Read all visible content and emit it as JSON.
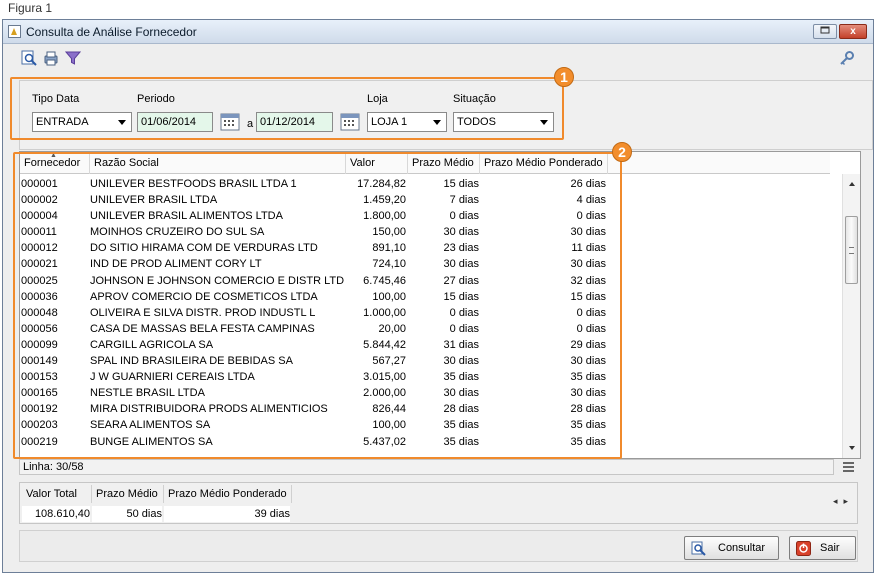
{
  "figure_label": "Figura 1",
  "window": {
    "title": "Consulta de Análise Fornecedor",
    "close_glyph": "x"
  },
  "filters": {
    "tipo_data_label": "Tipo Data",
    "tipo_data_value": "ENTRADA",
    "periodo_label": "Periodo",
    "date_start": "01/06/2014",
    "date_separator": "a",
    "date_end": "01/12/2014",
    "loja_label": "Loja",
    "loja_value": "LOJA 1",
    "situacao_label": "Situação",
    "situacao_value": "TODOS"
  },
  "badges": {
    "filters": "1",
    "grid": "2"
  },
  "grid": {
    "columns": [
      "Fornecedor",
      "Razão Social",
      "Valor",
      "Prazo Médio",
      "Prazo Médio Ponderado"
    ],
    "rows": [
      {
        "code": "000001",
        "name": "UNILEVER BESTFOODS BRASIL LTDA 1",
        "valor": "17.284,82",
        "prazo": "15 dias",
        "ponderado": "26 dias"
      },
      {
        "code": "000002",
        "name": "UNILEVER BRASIL LTDA",
        "valor": "1.459,20",
        "prazo": "7 dias",
        "ponderado": "4 dias"
      },
      {
        "code": "000004",
        "name": "UNILEVER BRASIL ALIMENTOS LTDA",
        "valor": "1.800,00",
        "prazo": "0 dias",
        "ponderado": "0 dias"
      },
      {
        "code": "000011",
        "name": "MOINHOS CRUZEIRO DO SUL SA",
        "valor": "150,00",
        "prazo": "30 dias",
        "ponderado": "30 dias"
      },
      {
        "code": "000012",
        "name": "DO SITIO HIRAMA COM DE VERDURAS LTD",
        "valor": "891,10",
        "prazo": "23 dias",
        "ponderado": "11 dias"
      },
      {
        "code": "000021",
        "name": "IND DE PROD ALIMENT CORY LT",
        "valor": "724,10",
        "prazo": "30 dias",
        "ponderado": "30 dias"
      },
      {
        "code": "000025",
        "name": "JOHNSON E JOHNSON COMERCIO E DISTR LTD",
        "valor": "6.745,46",
        "prazo": "27 dias",
        "ponderado": "32 dias"
      },
      {
        "code": "000036",
        "name": "APROV COMERCIO DE COSMETICOS LTDA",
        "valor": "100,00",
        "prazo": "15 dias",
        "ponderado": "15 dias"
      },
      {
        "code": "000048",
        "name": "OLIVEIRA E SILVA DISTR. PROD INDUSTL L",
        "valor": "1.000,00",
        "prazo": "0 dias",
        "ponderado": "0 dias"
      },
      {
        "code": "000056",
        "name": "CASA DE MASSAS BELA FESTA CAMPINAS",
        "valor": "20,00",
        "prazo": "0 dias",
        "ponderado": "0 dias"
      },
      {
        "code": "000099",
        "name": "CARGILL AGRICOLA SA",
        "valor": "5.844,42",
        "prazo": "31 dias",
        "ponderado": "29 dias"
      },
      {
        "code": "000149",
        "name": "SPAL IND BRASILEIRA DE BEBIDAS SA",
        "valor": "567,27",
        "prazo": "30 dias",
        "ponderado": "30 dias"
      },
      {
        "code": "000153",
        "name": "J W GUARNIERI CEREAIS LTDA",
        "valor": "3.015,00",
        "prazo": "35 dias",
        "ponderado": "35 dias"
      },
      {
        "code": "000165",
        "name": "NESTLE BRASIL LTDA",
        "valor": "2.000,00",
        "prazo": "30 dias",
        "ponderado": "30 dias"
      },
      {
        "code": "000192",
        "name": "MIRA DISTRIBUIDORA PRODS ALIMENTICIOS",
        "valor": "826,44",
        "prazo": "28 dias",
        "ponderado": "28 dias"
      },
      {
        "code": "000203",
        "name": "SEARA ALIMENTOS SA",
        "valor": "100,00",
        "prazo": "35 dias",
        "ponderado": "35 dias"
      },
      {
        "code": "000219",
        "name": "BUNGE ALIMENTOS SA",
        "valor": "5.437,02",
        "prazo": "35 dias",
        "ponderado": "35 dias"
      }
    ]
  },
  "status": {
    "linha": "Linha: 30/58"
  },
  "summary": {
    "valor_total_label": "Valor Total",
    "prazo_medio_label": "Prazo Médio",
    "prazo_ponderado_label": "Prazo Médio Ponderado",
    "valor_total": "108.610,40",
    "prazo_medio": "50 dias",
    "prazo_ponderado": "39 dias"
  },
  "buttons": {
    "consultar": "Consultar",
    "sair": "Sair"
  },
  "colors": {
    "highlight": "#f08a2c",
    "date_field_bg": "#e4f7ea"
  },
  "icons": [
    "app-icon",
    "preview-icon",
    "print-icon",
    "filter-icon",
    "key-icon",
    "calendar-icon",
    "consultar-icon",
    "sair-icon"
  ]
}
